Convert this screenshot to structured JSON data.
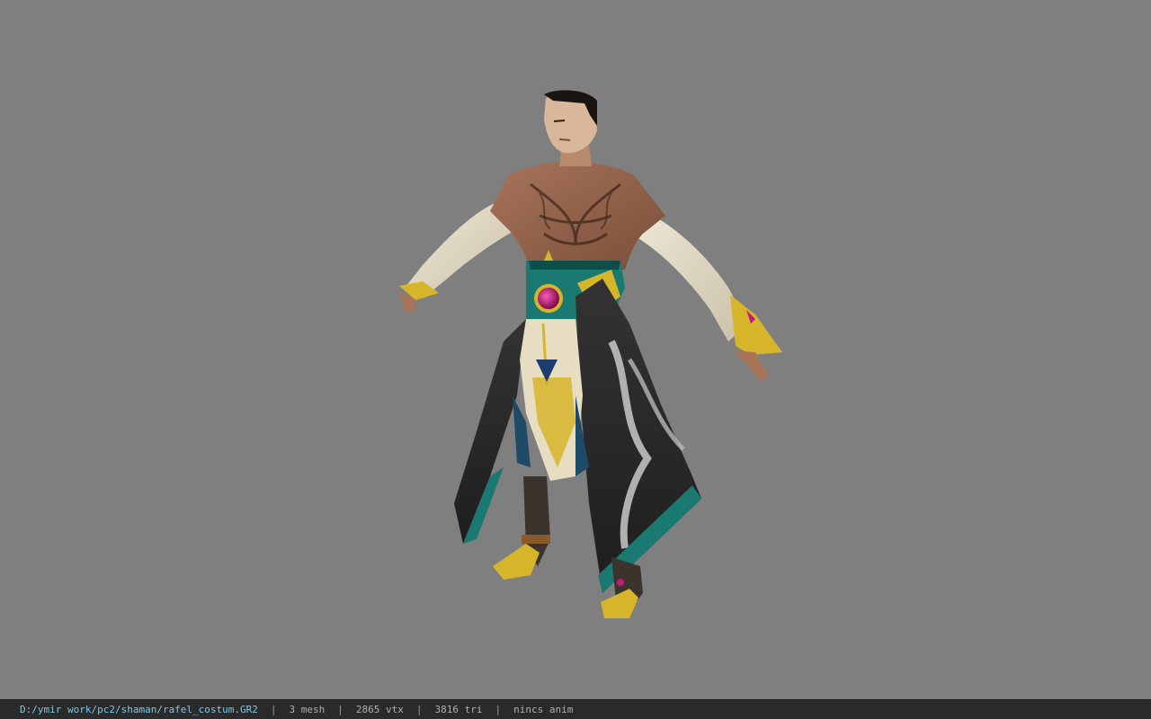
{
  "viewer": {
    "background_color": "#7f7f7f",
    "model": {
      "icon": "character-model",
      "description_colors": {
        "skin": "#b07a5c",
        "sleeves": "#e8e0cc",
        "robe_dark": "#2b2b2b",
        "robe_teal": "#1a7a72",
        "gold": "#d6b52a",
        "gem": "#c2187a"
      }
    }
  },
  "statusbar": {
    "file_path": "D:/ymir work/pc2/shaman/rafel_costum.GR2",
    "separator": "|",
    "mesh": "3 mesh",
    "vtx": "2865 vtx",
    "tri": "3816 tri",
    "anim": "nincs anim",
    "path_color": "#7fc7e6"
  }
}
